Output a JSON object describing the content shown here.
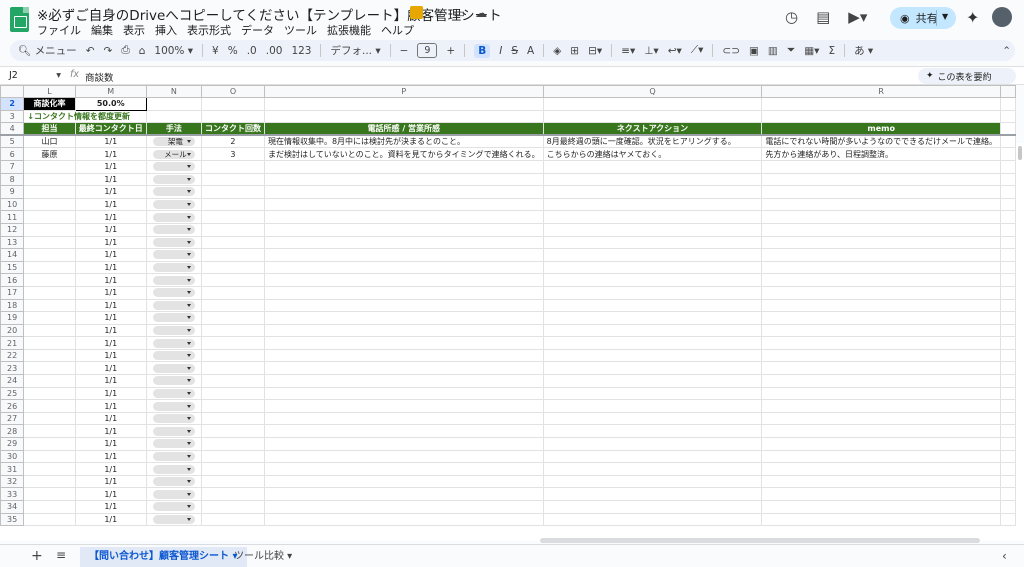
{
  "doc": {
    "title": "※必ずご自身のDriveへコピーしてください【テンプレート】顧客管理シート"
  },
  "menu": [
    "ファイル",
    "編集",
    "表示",
    "挿入",
    "表示形式",
    "データ",
    "ツール",
    "拡張機能",
    "ヘルプ"
  ],
  "share_label": "共有",
  "toolbar": {
    "menu_search": "メニュー",
    "zoom": "100%",
    "currency": "¥",
    "percent": "%",
    "dec_less": ".0",
    "dec_more": ".00",
    "num_format": "123",
    "font": "デフォ...",
    "font_size": "9",
    "bold": "B",
    "italic": "I",
    "strike": "S",
    "text_color": "A",
    "ime": "あ"
  },
  "formula": {
    "cell_ref": "J2",
    "fx": "fx",
    "content": "商談数"
  },
  "summarize_label": "この表を要約",
  "columns": [
    "L",
    "M",
    "N",
    "O",
    "P",
    "Q",
    "R"
  ],
  "kpi": {
    "label": "商談化率",
    "value": "50.0%"
  },
  "note": "↓コンタクト情報を都度更新",
  "headers": [
    "担当",
    "最終コンタクト日",
    "手法",
    "コンタクト回数",
    "電話所感 / 営業所感",
    "ネクストアクション",
    "memo"
  ],
  "rows": [
    {
      "rn": "5",
      "owner": "山口",
      "date": "1/1",
      "method": "架電",
      "count": "2",
      "sales": "現在情報収集中。8月中には検討先が決まるとのこと。",
      "next": "8月最終週の頭に一度確認。状況をヒアリングする。",
      "memo": "電話にでれない時間が多いようなのでできるだけメールで連絡。"
    },
    {
      "rn": "6",
      "owner": "藤原",
      "date": "1/1",
      "method": "メール",
      "count": "3",
      "sales": "まだ検討はしていないとのこと。資料を見てからタイミングで連絡くれる。",
      "next": "こちらからの連絡はヤメておく。",
      "memo": "先方から連絡があり、日程調整済。"
    }
  ],
  "empty_rows": [
    "7",
    "8",
    "9",
    "10",
    "11",
    "12",
    "13",
    "14",
    "15",
    "16",
    "17",
    "18",
    "19",
    "20",
    "21",
    "22",
    "23",
    "24",
    "25",
    "26",
    "27",
    "28",
    "29",
    "30",
    "31",
    "32",
    "33",
    "34",
    "35"
  ],
  "default_date": "1/1",
  "tabs": [
    "【問い合わせ】顧客管理シート",
    "ツール比較"
  ],
  "colors": {
    "header_green": "#38761d",
    "share_bg": "#c2e7ff",
    "active_tab": "#0b57d0"
  }
}
